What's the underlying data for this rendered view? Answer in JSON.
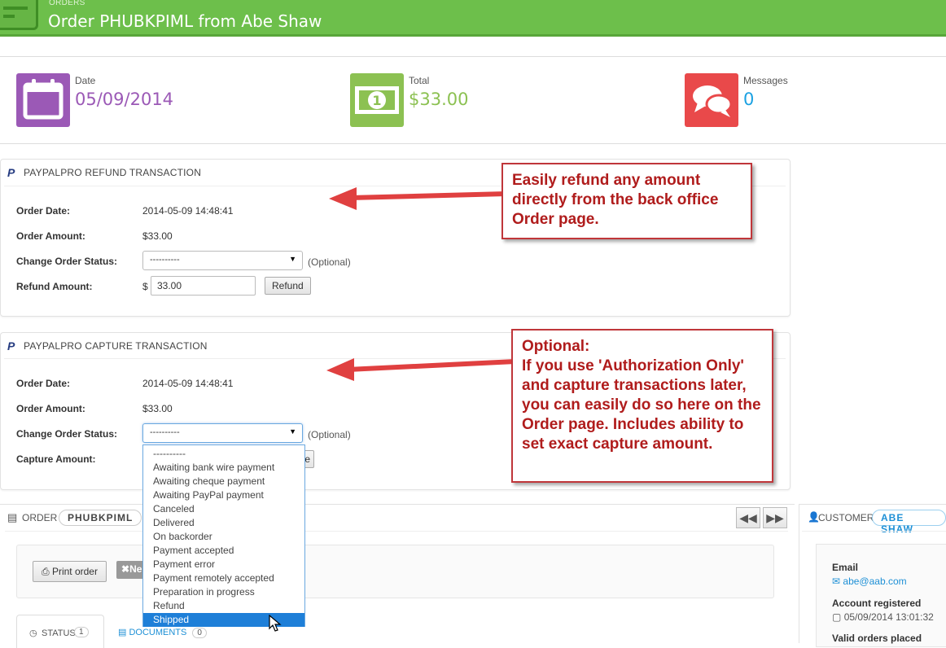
{
  "header": {
    "breadcrumb": "ORDERS",
    "title": "Order PHUBKPIML from Abe Shaw"
  },
  "kpis": [
    {
      "label": "Date",
      "value": "05/09/2014",
      "color": "#9b59b6",
      "icon": "calendar-icon"
    },
    {
      "label": "Total",
      "value": "$33.00",
      "color": "#8cc152",
      "icon": "money-icon",
      "glyph": "1"
    },
    {
      "label": "Messages",
      "value": "0",
      "color": "#e9494a",
      "valueColor": "#1ba1e2",
      "icon": "chat-bubbles-icon"
    }
  ],
  "refund": {
    "title": "PAYPALPRO REFUND TRANSACTION",
    "order_date_label": "Order Date:",
    "order_date": "2014-05-09 14:48:41",
    "order_amount_label": "Order Amount:",
    "order_amount": "$33.00",
    "status_label": "Change Order Status:",
    "status_value": "----------",
    "optional": "(Optional)",
    "amount_label": "Refund Amount:",
    "currency": "$",
    "amount_value": "33.00",
    "button": "Refund"
  },
  "capture": {
    "title": "PAYPALPRO CAPTURE TRANSACTION",
    "order_date_label": "Order Date:",
    "order_date": "2014-05-09 14:48:41",
    "order_amount_label": "Order Amount:",
    "order_amount": "$33.00",
    "status_label": "Change Order Status:",
    "status_value": "----------",
    "optional": "(Optional)",
    "amount_label": "Capture Amount:",
    "button_fragment": "e"
  },
  "dropdown": {
    "options": [
      "----------",
      "Awaiting bank wire payment",
      "Awaiting cheque payment",
      "Awaiting PayPal payment",
      "Canceled",
      "Delivered",
      "On backorder",
      "Payment accepted",
      "Payment error",
      "Payment remotely accepted",
      "Preparation in progress",
      "Refund",
      "Shipped"
    ],
    "selected_index": 12
  },
  "callouts": {
    "refund": "Easily refund any amount directly from the back office Order page.",
    "capture_heading": "Optional:",
    "capture": "If you use 'Authorization Only' and capture transactions later, you can easily do so here on the Order page. Includes ability to set exact capture amount."
  },
  "order": {
    "label": "ORDER",
    "reference": "PHUBKPIML",
    "print_button": "Print order",
    "new_fragment": "Ne",
    "tab_status": "STATUS",
    "tab_status_count": "1",
    "tab_documents": "DOCUMENTS",
    "tab_documents_count": "0"
  },
  "customer": {
    "label": "CUSTOMER",
    "name": "ABE SHAW",
    "email_label": "Email",
    "email": "abe@aab.com",
    "registered_label": "Account registered",
    "registered": "05/09/2014 13:01:32",
    "valid_orders_label": "Valid orders placed"
  }
}
